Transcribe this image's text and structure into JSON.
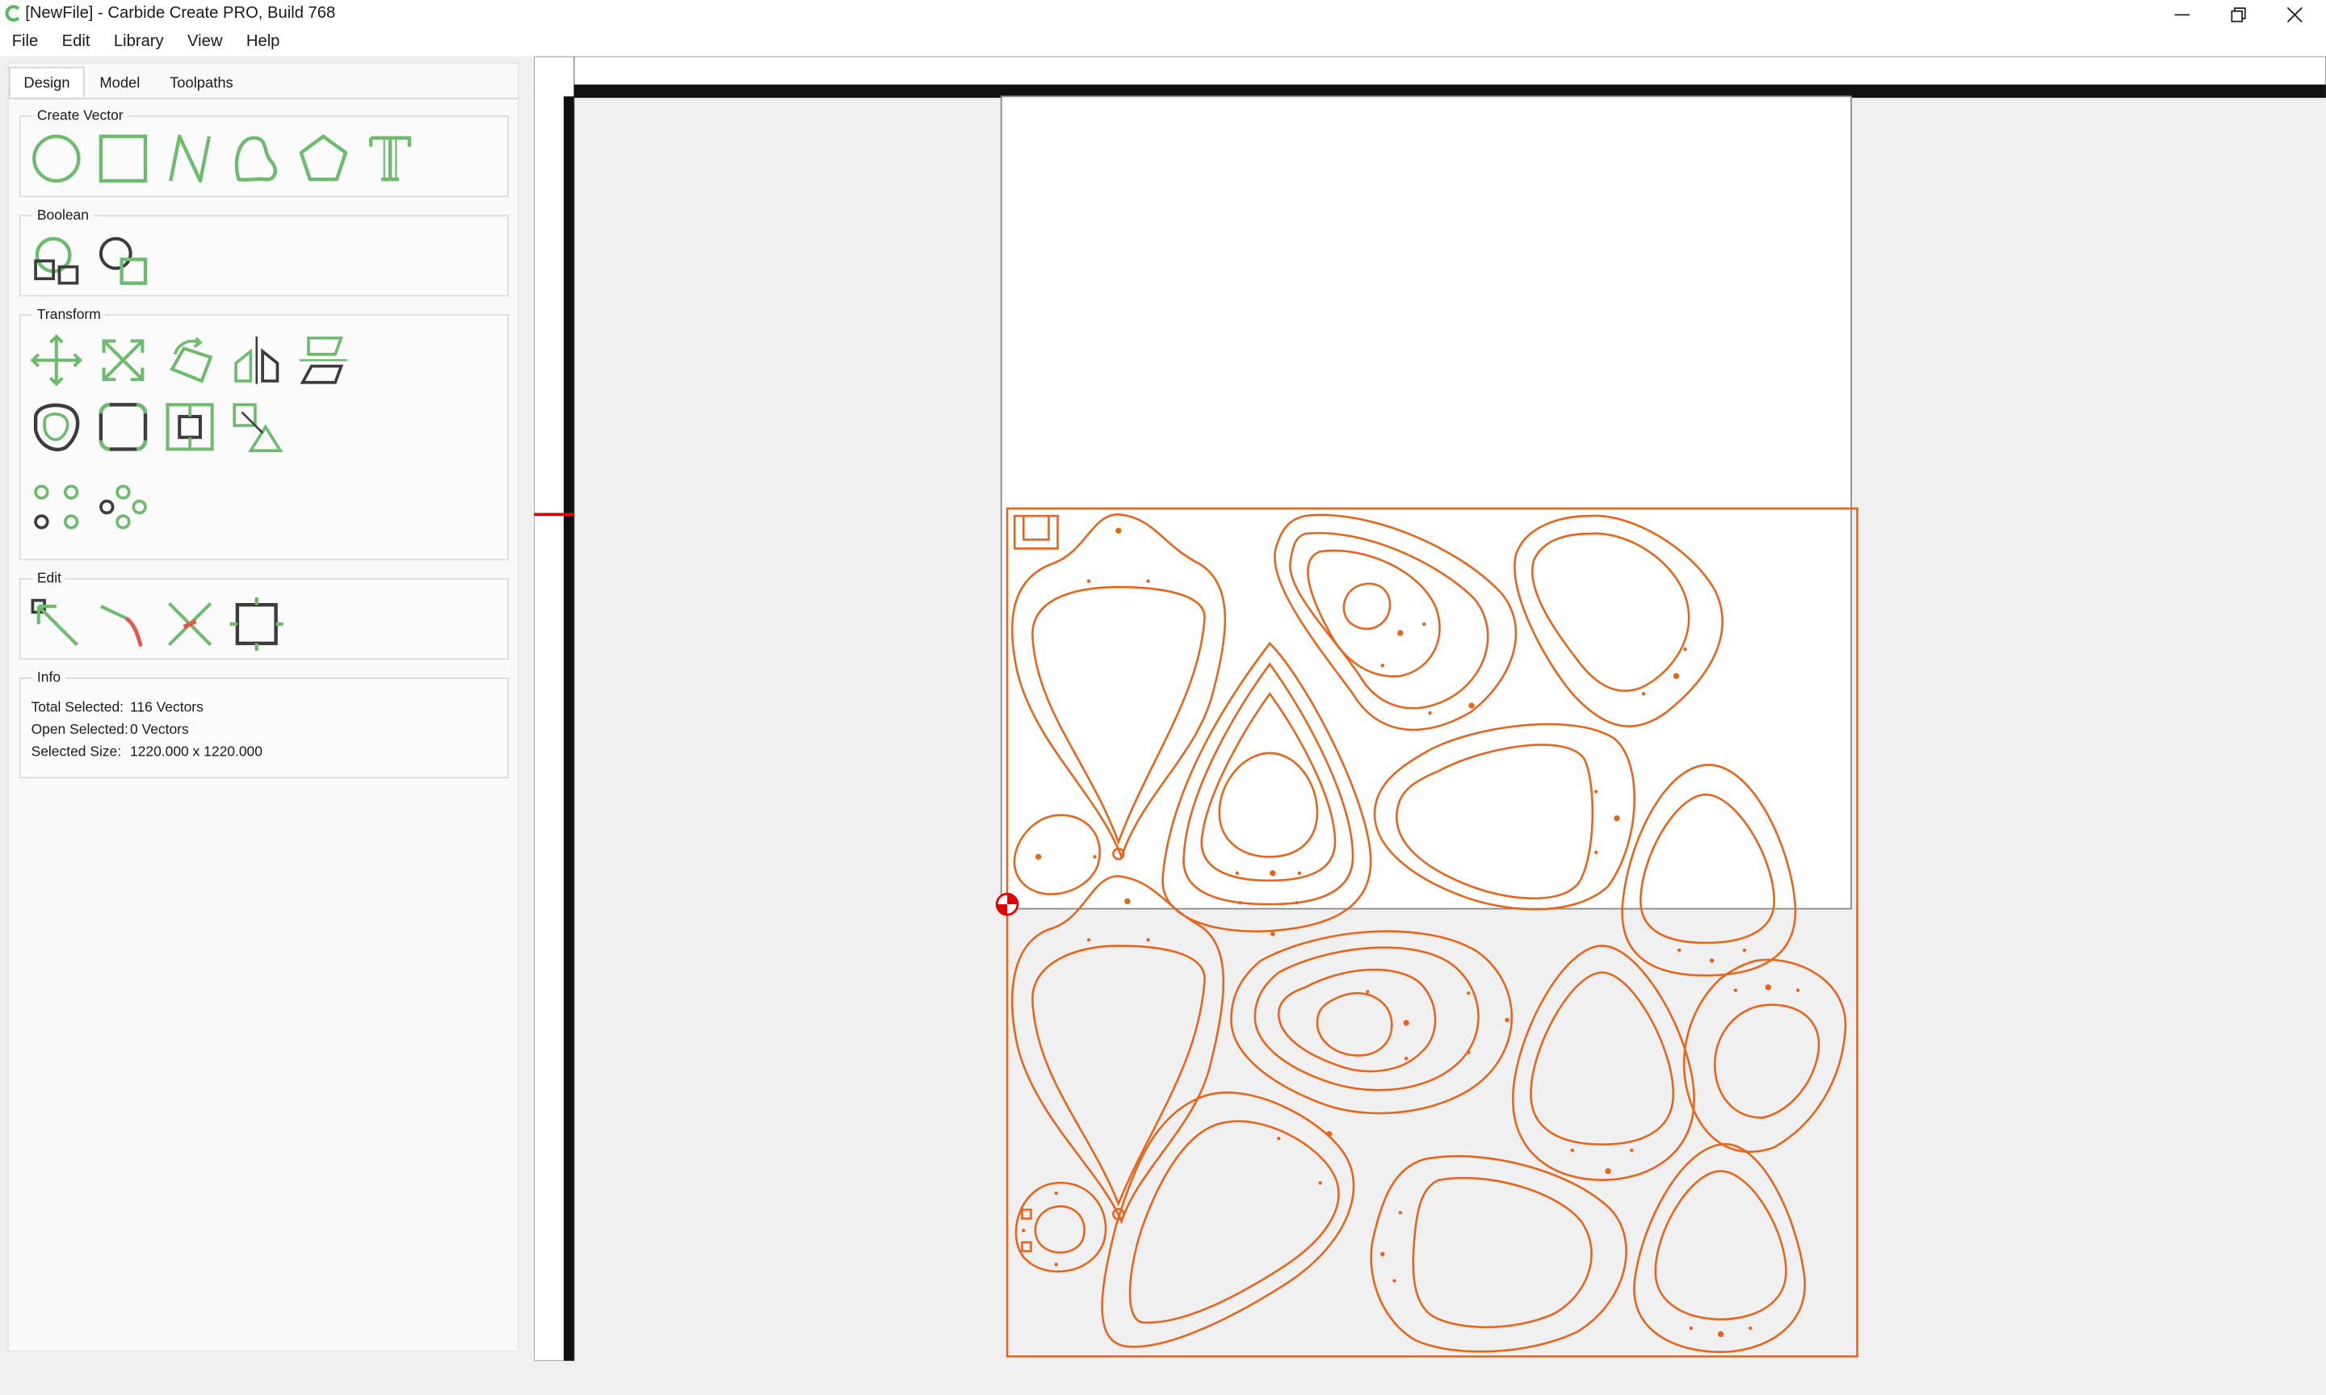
{
  "window": {
    "title": "[NewFile] - Carbide Create PRO, Build 768",
    "minimize_glyph": "—",
    "restore_glyph": "❐",
    "close_glyph": "✕"
  },
  "menu": {
    "items": [
      {
        "label": "File"
      },
      {
        "label": "Edit"
      },
      {
        "label": "Library"
      },
      {
        "label": "View"
      },
      {
        "label": "Help"
      }
    ]
  },
  "tabs": [
    {
      "label": "Design",
      "active": true
    },
    {
      "label": "Model",
      "active": false
    },
    {
      "label": "Toolpaths",
      "active": false
    }
  ],
  "groups": {
    "create_vector": {
      "title": "Create Vector",
      "tools": [
        "circle-icon",
        "rectangle-icon",
        "polyline-icon",
        "curve-icon",
        "polygon-icon",
        "text-icon"
      ]
    },
    "boolean": {
      "title": "Boolean",
      "tools": [
        "boolean-union-icon",
        "boolean-subtract-icon"
      ]
    },
    "transform": {
      "title": "Transform",
      "tools": [
        "move-icon",
        "scale-icon",
        "rotate-icon",
        "mirror-icon",
        "shear-icon",
        "offset-icon",
        "fillet-icon",
        "align-icon",
        "distribute-icon",
        "grid-array-icon",
        "circular-array-icon"
      ]
    },
    "edit": {
      "title": "Edit",
      "tools": [
        "node-edit-icon",
        "trim-icon",
        "delete-segment-icon",
        "bounding-box-icon"
      ]
    },
    "info": {
      "title": "Info",
      "total_selected_label": "Total Selected:",
      "total_selected_value": "116 Vectors",
      "open_selected_label": "Open Selected:",
      "open_selected_value": "0 Vectors",
      "selected_size_label": "Selected Size:",
      "selected_size_value": "1220.000 x 1220.000"
    }
  },
  "colors": {
    "accent_green": "#6dbb6d",
    "vector_orange": "#e8641a",
    "dark_icon": "#3c3c3c",
    "origin_red": "#e00000"
  }
}
